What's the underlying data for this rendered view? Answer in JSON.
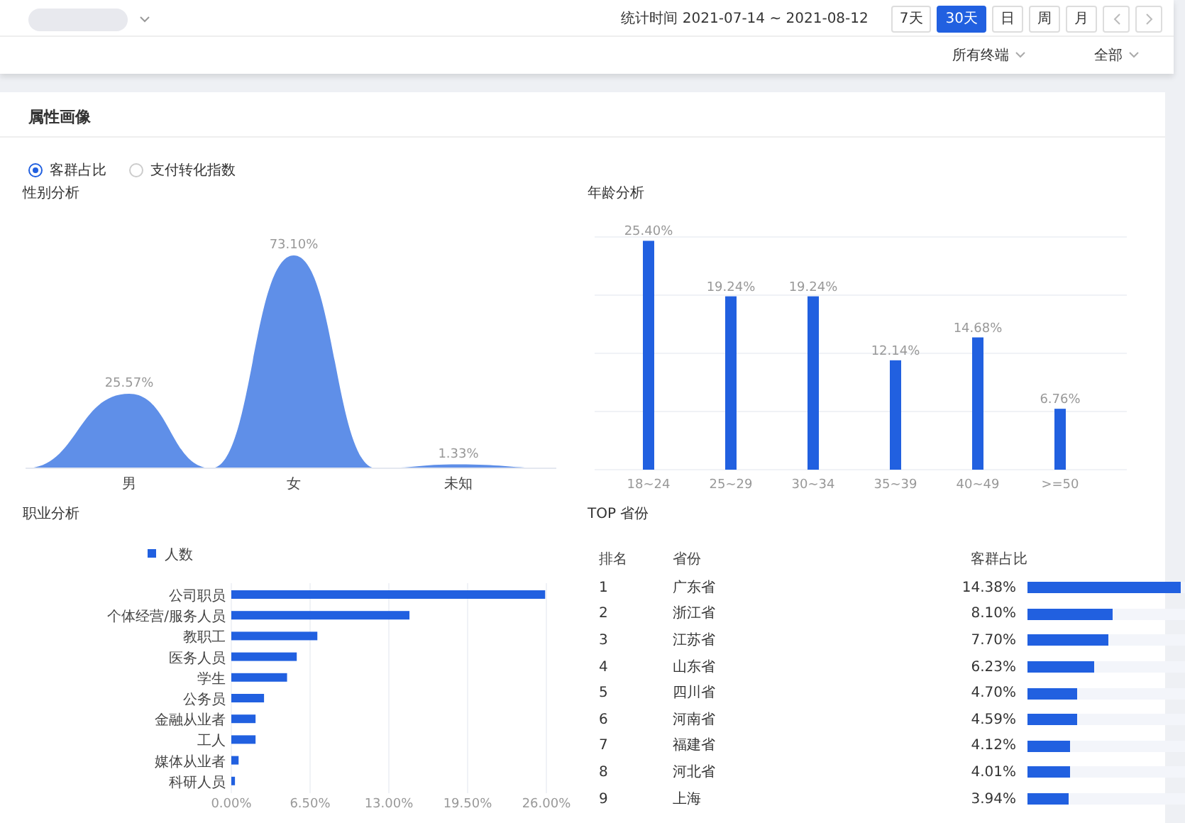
{
  "header": {
    "stat_label": "统计时间 2021-07-14 ~ 2021-08-12",
    "range_buttons": [
      {
        "label": "7天",
        "selected": false
      },
      {
        "label": "30天",
        "selected": true
      },
      {
        "label": "日",
        "selected": false
      },
      {
        "label": "周",
        "selected": false
      },
      {
        "label": "月",
        "selected": false
      }
    ],
    "filters": [
      {
        "label": "所有终端"
      },
      {
        "label": "全部"
      }
    ]
  },
  "panel": {
    "title": "属性画像",
    "radios": [
      {
        "label": "客群占比",
        "selected": true
      },
      {
        "label": "支付转化指数",
        "selected": false
      }
    ],
    "gender": {
      "title": "性别分析",
      "items": [
        {
          "label": "男",
          "share": "25.57%"
        },
        {
          "label": "女",
          "share": "73.10%"
        },
        {
          "label": "未知",
          "share": "1.33%"
        }
      ]
    },
    "age": {
      "title": "年龄分析",
      "chart_data": {
        "type": "bar",
        "categories": [
          "18~24",
          "25~29",
          "30~34",
          "35~39",
          "40~49",
          ">=50"
        ],
        "values": [
          25.4,
          19.24,
          19.24,
          12.14,
          14.68,
          6.76
        ],
        "grid": true,
        "data_labels": true,
        "value_labels": [
          "25.40%",
          "19.24%",
          "19.24%",
          "12.14%",
          "14.68%",
          "6.76%"
        ]
      }
    },
    "occupation": {
      "title": "职业分析",
      "chart_data": {
        "type": "bar",
        "orientation": "horizontal",
        "categories": [
          "公司职员",
          "个体经营/服务人员",
          "教职工",
          "医务人员",
          "学生",
          "公务员",
          "金融从业者",
          "工人",
          "媒体从业者",
          "科研人员"
        ],
        "series": [
          {
            "name": "人数",
            "color": "#2160e0",
            "values": [
              25.9,
              14.7,
              7.1,
              5.4,
              4.6,
              2.7,
              2.0,
              2.0,
              0.6,
              0.3
            ]
          }
        ],
        "xlim": [
          0,
          26
        ],
        "grid": true,
        "xticks": [
          {
            "value": 0,
            "label": "0.00%"
          },
          {
            "value": 6.5,
            "label": "6.50%"
          },
          {
            "value": 13,
            "label": "13.00%"
          },
          {
            "value": 19.5,
            "label": "19.50%"
          },
          {
            "value": 26,
            "label": "26.00%"
          }
        ]
      }
    },
    "provinces": {
      "title": "TOP 省份",
      "columns": [
        "排名",
        "省份",
        "客群占比"
      ],
      "rows": [
        {
          "rank": "1",
          "province": "广东省",
          "share": "14.38%",
          "level": 0.96
        },
        {
          "rank": "2",
          "province": "浙江省",
          "share": "8.10%",
          "level": 0.54
        },
        {
          "rank": "3",
          "province": "江苏省",
          "share": "7.70%",
          "level": 0.51
        },
        {
          "rank": "4",
          "province": "山东省",
          "share": "6.23%",
          "level": 0.42
        },
        {
          "rank": "5",
          "province": "四川省",
          "share": "4.70%",
          "level": 0.31
        },
        {
          "rank": "6",
          "province": "河南省",
          "share": "4.59%",
          "level": 0.31
        },
        {
          "rank": "7",
          "province": "福建省",
          "share": "4.12%",
          "level": 0.27
        },
        {
          "rank": "8",
          "province": "河北省",
          "share": "4.01%",
          "level": 0.27
        },
        {
          "rank": "9",
          "province": "上海",
          "share": "3.94%",
          "level": 0.26
        }
      ]
    }
  }
}
